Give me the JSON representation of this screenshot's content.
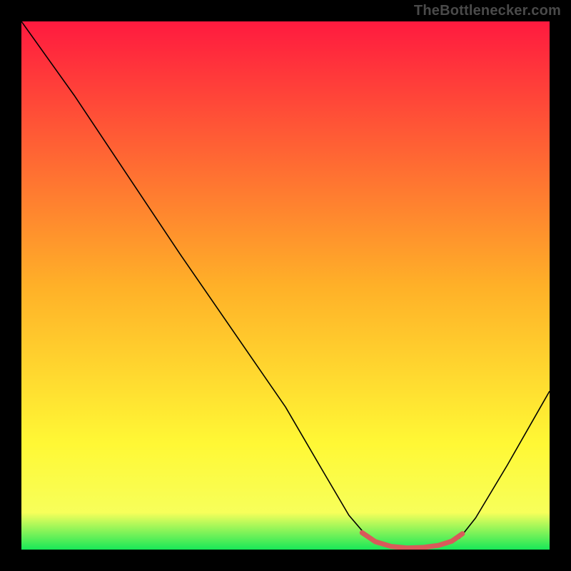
{
  "watermark": "TheBottlenecker.com",
  "chart_data": {
    "type": "line",
    "title": "",
    "xlabel": "",
    "ylabel": "",
    "xlim": [
      0,
      100
    ],
    "ylim": [
      0,
      100
    ],
    "grid": false,
    "background_gradient": {
      "stops": [
        {
          "offset": 0.0,
          "color": "#ff1a3f"
        },
        {
          "offset": 0.5,
          "color": "#ffb028"
        },
        {
          "offset": 0.8,
          "color": "#fff835"
        },
        {
          "offset": 0.93,
          "color": "#f7ff5a"
        },
        {
          "offset": 1.0,
          "color": "#18e858"
        }
      ]
    },
    "series": [
      {
        "name": "bottleneck-curve",
        "type": "line",
        "color": "#000000",
        "width": 1.6,
        "points": [
          {
            "x": 0.0,
            "y": 100.0
          },
          {
            "x": 5.0,
            "y": 93.0
          },
          {
            "x": 10.0,
            "y": 86.0
          },
          {
            "x": 30.0,
            "y": 56.0
          },
          {
            "x": 50.0,
            "y": 27.0
          },
          {
            "x": 57.0,
            "y": 15.0
          },
          {
            "x": 62.0,
            "y": 6.5
          },
          {
            "x": 65.0,
            "y": 3.0
          },
          {
            "x": 68.0,
            "y": 1.0
          },
          {
            "x": 72.0,
            "y": 0.3
          },
          {
            "x": 76.0,
            "y": 0.3
          },
          {
            "x": 80.0,
            "y": 0.8
          },
          {
            "x": 83.0,
            "y": 2.2
          },
          {
            "x": 86.0,
            "y": 6.0
          },
          {
            "x": 92.0,
            "y": 16.0
          },
          {
            "x": 100.0,
            "y": 30.0
          }
        ]
      },
      {
        "name": "optimal-band",
        "type": "line",
        "color": "#d85a5a",
        "width": 7,
        "linecap": "round",
        "points": [
          {
            "x": 64.5,
            "y": 3.2
          },
          {
            "x": 67.0,
            "y": 1.5
          },
          {
            "x": 70.0,
            "y": 0.6
          },
          {
            "x": 73.0,
            "y": 0.3
          },
          {
            "x": 76.0,
            "y": 0.4
          },
          {
            "x": 79.0,
            "y": 0.8
          },
          {
            "x": 81.5,
            "y": 1.6
          },
          {
            "x": 83.5,
            "y": 3.0
          }
        ]
      }
    ]
  }
}
